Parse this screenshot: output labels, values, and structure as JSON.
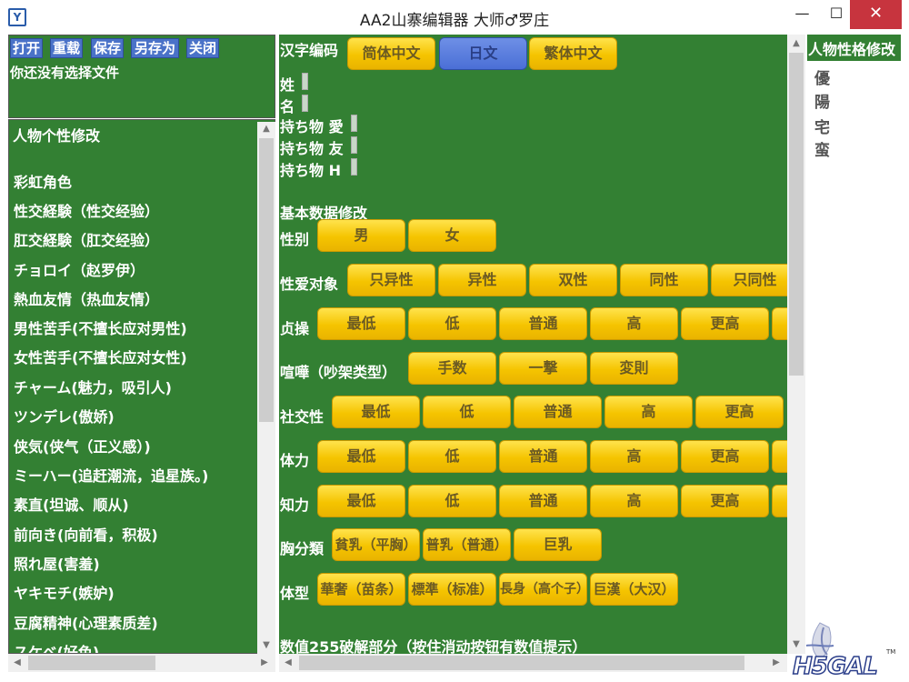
{
  "window": {
    "title": "AA2山寨编辑器 大师♂罗庄",
    "minimize": "—",
    "maximize": "☐",
    "close": "✕"
  },
  "file_panel": {
    "buttons": [
      "打开",
      "重载",
      "保存",
      "另存为",
      "关闭"
    ],
    "message": "你还没有选择文件"
  },
  "traits": {
    "title": "人物个性修改",
    "items": [
      "彩虹角色",
      "性交経験（性交经验）",
      "肛交経験（肛交经验）",
      "チョロイ（赵罗伊）",
      "熱血友情（热血友情）",
      "男性苦手(不擅长应对男性)",
      "女性苦手(不擅长应对女性)",
      "チャーム(魅力，吸引人)",
      "ツンデレ(傲娇)",
      "侠気(侠气（正义感）)",
      "ミーハー(追赶潮流，追星族。)",
      "素直(坦诚、顺从)",
      "前向き(向前看，积极)",
      "照れ屋(害羞)",
      "ヤキモチ(嫉妒)",
      "豆腐精神(心理素质差)",
      "スケベ(好色)"
    ]
  },
  "main": {
    "encoding_label": "汉字编码",
    "encoding_options": [
      "简体中文",
      "日文",
      "繁体中文"
    ],
    "encoding_selected": "日文",
    "surname_label": "姓",
    "givenname_label": "名",
    "items_love_label": "持ち物 愛",
    "items_friend_label": "持ち物 友",
    "items_h_label": "持ち物 H",
    "basic_title": "基本数据修改",
    "gender": {
      "label": "性别",
      "options": [
        "男",
        "女"
      ]
    },
    "orientation": {
      "label": "性爱对象",
      "options": [
        "只异性",
        "异性",
        "双性",
        "同性",
        "只同性"
      ]
    },
    "chastity": {
      "label": "贞操",
      "options": [
        "最低",
        "低",
        "普通",
        "高",
        "更高"
      ]
    },
    "fight": {
      "label": "喧嘩（吵架类型）",
      "options": [
        "手数",
        "一撃",
        "変則"
      ]
    },
    "social": {
      "label": "社交性",
      "options": [
        "最低",
        "低",
        "普通",
        "高",
        "更高"
      ]
    },
    "stamina": {
      "label": "体力",
      "options": [
        "最低",
        "低",
        "普通",
        "高",
        "更高"
      ]
    },
    "intellect": {
      "label": "知力",
      "options": [
        "最低",
        "低",
        "普通",
        "高",
        "更高"
      ]
    },
    "chest": {
      "label": "胸分類",
      "options": [
        "貧乳（平胸）",
        "普乳（普通）",
        "巨乳"
      ]
    },
    "body": {
      "label": "体型",
      "options": [
        "華奢（苗条）",
        "標準（标准）",
        "長身（高个子）",
        "巨漢（大汉）"
      ]
    },
    "section_255": "数值255破解部分（按住消动按钮有数值提示）"
  },
  "right": {
    "title": "人物性格修改",
    "items": [
      "優",
      "陽",
      "宅",
      "蛮"
    ]
  },
  "logo": {
    "text": "H5GAL",
    "tm": "TM"
  },
  "colors": {
    "panel_green": "#338033",
    "button_yellow": "#f5c400",
    "selected_blue": "#4a6fd6",
    "close_red": "#c7343e"
  }
}
